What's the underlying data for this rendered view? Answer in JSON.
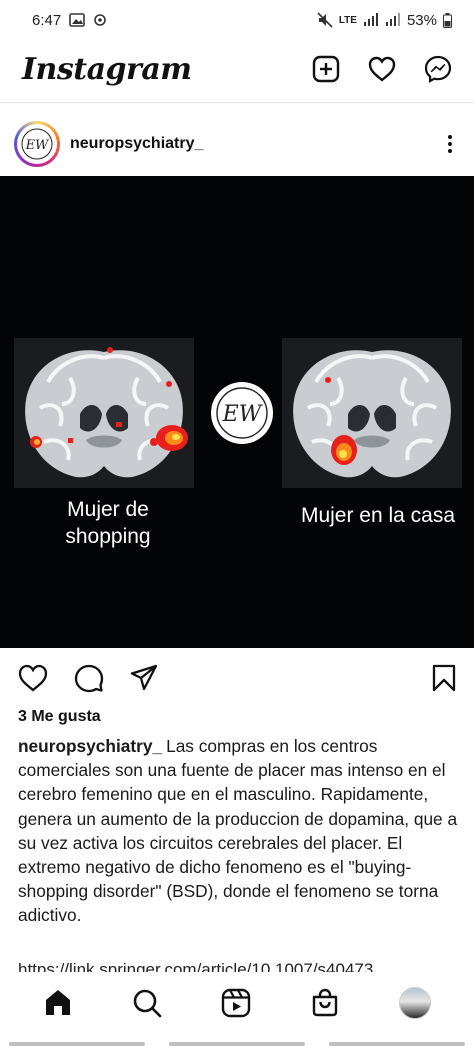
{
  "status_bar": {
    "time": "6:47",
    "network": "LTE",
    "battery": "53%"
  },
  "app": {
    "logo": "Instagram",
    "header_icons": [
      "new-post-icon",
      "heart-icon",
      "messenger-icon"
    ]
  },
  "post": {
    "username": "neuropsychiatry_",
    "avatar_mark": "EW",
    "image": {
      "left_label": "Mujer de shopping",
      "right_label": "Mujer en la casa",
      "center_mark": "EW",
      "background": "#030405"
    },
    "likes": "3 Me gusta",
    "caption_user": "neuropsychiatry_",
    "caption_text": "Las compras en los centros comerciales son una fuente de placer mas intenso en el cerebro femenino que en el masculino. Rapidamente, genera un aumento de la produccion de dopamina, que a su vez activa los circuitos cerebrales del placer. El extremo negativo de dicho fenomeno es el \"buying-shopping disorder\" (BSD), donde el fenomeno se torna adictivo.",
    "link": "https://link.springer.com/article/10.1007/s40473"
  },
  "bottom_nav": [
    "home-icon",
    "search-icon",
    "reels-icon",
    "shop-icon",
    "profile-avatar"
  ]
}
